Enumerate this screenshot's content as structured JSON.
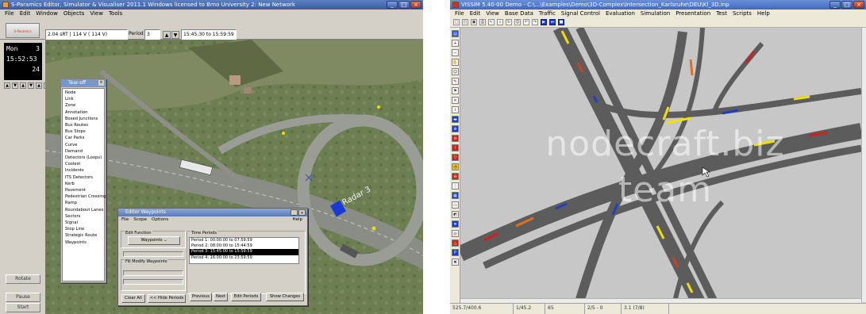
{
  "left_app": {
    "title": "S-Paramics Editor, Simulator & Visualiser 2011.1 Windows licensed to Brno University 2: New Network",
    "menu": [
      "File",
      "Edit",
      "Window",
      "Objects",
      "View",
      "Tools"
    ],
    "toolbar": {
      "logo_text": "S-Paramics",
      "coord_text": "2.04 sRT | 114 V ( 114 V)",
      "period_label": "Period",
      "period_value": "3",
      "time_range": "15:45:30 to 15:59:59"
    },
    "clock": {
      "day": "Mon",
      "day_num": "3",
      "time": "15:52:53",
      "speed": "24"
    },
    "side_buttons": {
      "rotate": "Rotate",
      "pause": "Pause",
      "start": "Start"
    },
    "map_label": "Radar 3",
    "tearoff": {
      "title": "Tear-off",
      "items": [
        "Node",
        "Link",
        "Zone",
        "Annotation",
        "Boxed Junctions",
        "Bus Routes",
        "Bus Stops",
        "Car Parks",
        "Curve",
        "Demand",
        "Detectors (Loops)",
        "Coolest",
        "Incidents",
        "ITS Detectors",
        "Kerb",
        "Pavement",
        "Pedestrian Crossing",
        "Ramp",
        "Roundabout Lanes",
        "Sectors",
        "Signal",
        "Stop Line",
        "Strategic Route",
        "Waypoints"
      ]
    },
    "waypoints_dialog": {
      "title": "Editor Waypoints",
      "menu": [
        "File",
        "Scope",
        "Options"
      ],
      "help": "Help",
      "edit_function_label": "Edit Function",
      "function_value": "Waypoints",
      "fill_modify_label": "Fill Modify Waypoints",
      "time_periods_label": "Time Periods",
      "periods": [
        "Period 1: 00:00:00 to 07:59:59",
        "Period 2: 08:00:00 to 15:44:59",
        "Period 3: 15:45:00 to 15:59:59",
        "Period 4: 16:00:00 to 23:59:59"
      ],
      "selected_period_index": 2,
      "buttons": {
        "clear_all": "Clear All",
        "hide_periods": "<< Hide Periods",
        "previous": "Previous",
        "next": "Next",
        "edit_periods": "Edit Periods",
        "show_changes": "Show Changes"
      }
    }
  },
  "right_app": {
    "title": "VISSIM 5.40-00 Demo - C:\\...\\Examples\\Demo\\3D-Complex\\Intersection_Karlsruhe\\DEU\\Kl_3D.inp",
    "menu": [
      "File",
      "Edit",
      "View",
      "Base Data",
      "Traffic",
      "Signal Control",
      "Evaluation",
      "Simulation",
      "Presentation",
      "Test",
      "Scripts",
      "Help"
    ],
    "status": [
      "525.7/400.6",
      "1/45.2",
      "65",
      "2/5 - 0",
      "3.1 (7/8)"
    ],
    "watermark_line1": "nodecraft.biz",
    "watermark_line2": "team"
  },
  "colors": {
    "win_bg": "#d4d0c8",
    "title_blue": "#3a5da0",
    "road_gray": "#5c5c5c",
    "network_bg": "#c7c7c7"
  }
}
